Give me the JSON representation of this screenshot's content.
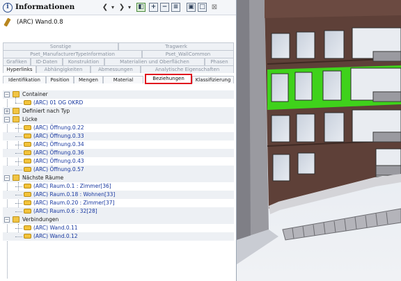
{
  "panel": {
    "title": "Informationen",
    "element_name": "(ARC) Wand.0.8",
    "toolbar": {
      "back": "❮",
      "dropdown1": "▾",
      "forward": "❯",
      "dropdown2": "▾",
      "close": "⊠"
    }
  },
  "tabs": {
    "row1": [
      "Sonstige",
      "Tragwerk"
    ],
    "row2": [
      "Pset_ManufacturerTypeInformation",
      "Pset_WallCommon"
    ],
    "row3": [
      "Grafiken",
      "ID-Daten",
      "Konstruktion",
      "Materialien und Oberflächen",
      "Phasen"
    ],
    "row4": [
      "Hyperlinks",
      "Abhängigkeiten",
      "Abmessungen",
      "Analytische Eigenschaften"
    ],
    "row5": [
      "Identifikation",
      "Position",
      "Mengen",
      "Material",
      "Beziehungen",
      "Klassifizierung"
    ],
    "active": "Beziehungen"
  },
  "tree": {
    "container": {
      "label": "Container",
      "children": [
        "(ARC) 01 OG OKRD"
      ]
    },
    "defined_by_type": {
      "label": "Definiert nach Typ"
    },
    "openings": {
      "label": "Lücke",
      "children": [
        "(ARC) Öffnung.0.22",
        "(ARC) Öffnung.0.33",
        "(ARC) Öffnung.0.34",
        "(ARC) Öffnung.0.36",
        "(ARC) Öffnung.0.43",
        "(ARC) Öffnung.0.57"
      ]
    },
    "rooms": {
      "label": "Nächste Räume",
      "children": [
        "(ARC) Raum.0.1 : Zimmer[36]",
        "(ARC) Raum.0.18 : Wohnen[33]",
        "(ARC) Raum.0.20 : Zimmer[37]",
        "(ARC) Raum.0.6 : 32[28]"
      ]
    },
    "connections": {
      "label": "Verbindungen",
      "children": [
        "(ARC) Wand.0.11",
        "(ARC) Wand.0.12"
      ]
    }
  },
  "colors": {
    "active_tab_border": "#e0141e",
    "highlight_wall": "#3fd21b",
    "facade": "#5e4038",
    "link_text": "#1838a0"
  },
  "icons": [
    "info-icon",
    "pencil-icon",
    "back-arrow-icon",
    "forward-arrow-icon",
    "folder-icon",
    "link-icon",
    "expand-icon",
    "collapse-icon",
    "close-icon"
  ]
}
